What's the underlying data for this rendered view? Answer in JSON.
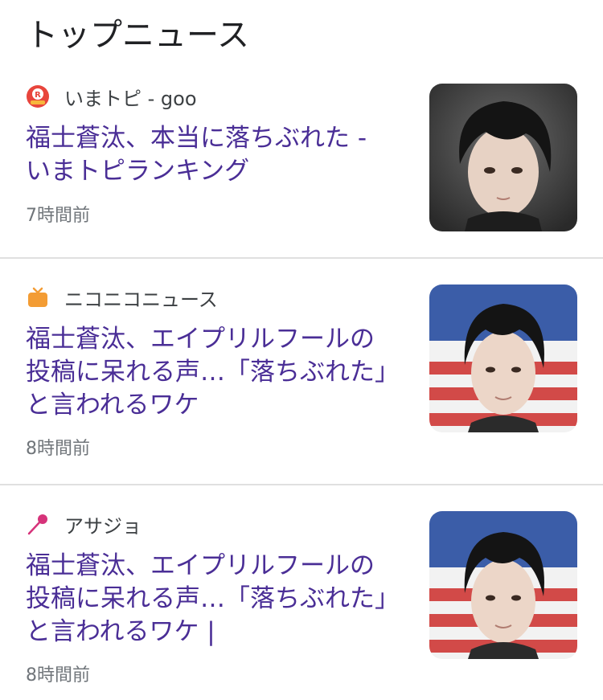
{
  "section": {
    "title": "トップニュース"
  },
  "articles": [
    {
      "source": "いまトピ - goo",
      "source_icon": "goo-ranking-icon",
      "headline": "福士蒼汰、本当に落ちぶれた - いまトピランキング",
      "time": "7時間前",
      "thumbnail": "portrait-dark-background"
    },
    {
      "source": "ニコニコニュース",
      "source_icon": "niconico-tv-icon",
      "headline": "福士蒼汰、エイプリルフールの投稿に呆れる声…「落ちぶれた」と言われるワケ",
      "time": "8時間前",
      "thumbnail": "portrait-flag-background"
    },
    {
      "source": "アサジョ",
      "source_icon": "asajo-pin-icon",
      "headline": "福士蒼汰、エイプリルフールの投稿に呆れる声…「落ちぶれた」と言われるワケ |",
      "time": "8時間前",
      "thumbnail": "portrait-flag-background"
    }
  ],
  "colors": {
    "headline": "#4a2e96",
    "meta": "#70757a",
    "divider": "#e0e0e0"
  }
}
